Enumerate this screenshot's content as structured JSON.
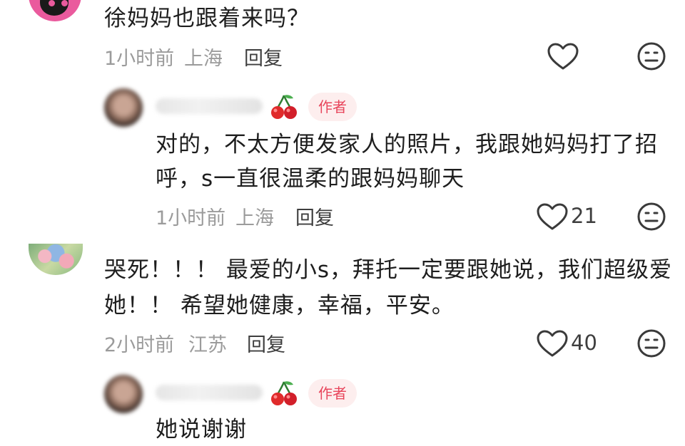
{
  "comments": [
    {
      "text": "徐妈妈也跟着来吗？",
      "time": "1小时前",
      "location": "上海",
      "reply_label": "回复",
      "like_count": "",
      "avatar": "pink-cat-avatar",
      "reply": {
        "author_badge": "作者",
        "badge_icon": "cherry-icon",
        "text_lines": [
          "对的，不太方便发家人的照片，我跟她妈妈打了招",
          "呼，s一直很温柔的跟妈妈聊天"
        ],
        "time": "1小时前",
        "location": "上海",
        "reply_label": "回复",
        "like_count": "21"
      }
    },
    {
      "text_lines": [
        "哭死！！！ 最爱的小s，拜托一定要跟她说，我们超级爱",
        "她！！ 希望她健康，幸福，平安。"
      ],
      "time": "2小时前",
      "location": "江苏",
      "reply_label": "回复",
      "like_count": "40",
      "avatar": "flower-photo-avatar",
      "reply": {
        "author_badge": "作者",
        "badge_icon": "cherry-icon",
        "text": "她说谢谢"
      }
    }
  ],
  "colors": {
    "badge_bg": "#fdeeee",
    "badge_text": "#e8455b",
    "meta": "#9b9b9b"
  }
}
